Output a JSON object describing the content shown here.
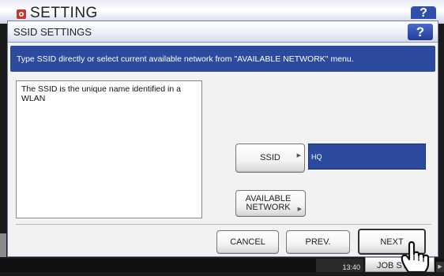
{
  "background": {
    "title": "SETTING",
    "help_label": "?",
    "clock_time": "13:40",
    "job_status_label": "JOB STATUS"
  },
  "dialog": {
    "title": "SSID SETTINGS",
    "help_label": "?",
    "instruction": "Type SSID directly or select current available network from \"AVAILABLE NETWORK\" menu.",
    "description": "The SSID is the unique name identified in a WLAN",
    "ssid": {
      "button_label": "SSID",
      "value": "HQ"
    },
    "available_network": {
      "label_line1": "AVAILABLE",
      "label_line2": "NETWORK"
    },
    "footer_buttons": {
      "cancel": "CANCEL",
      "prev": "PREV.",
      "next": "NEXT"
    }
  },
  "colors": {
    "accent_blue": "#2c4a9e",
    "dialog_bg": "#f2f2f2"
  },
  "icons": [
    "settings-icon",
    "help-icon",
    "hand-pointer-icon",
    "arrow-right-icon"
  ]
}
